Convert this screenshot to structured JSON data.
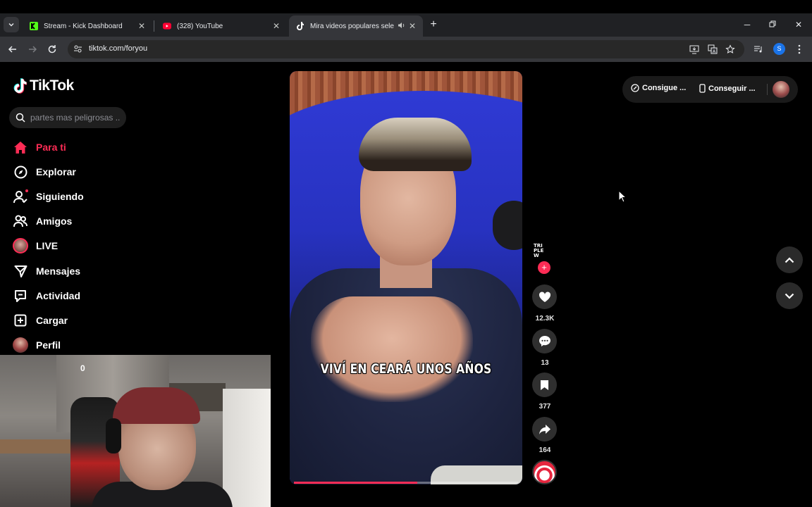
{
  "browser": {
    "tabs": [
      {
        "title": "Stream - Kick Dashboard",
        "favicon": "kick-icon"
      },
      {
        "title": "(328) YouTube",
        "favicon": "youtube-icon"
      },
      {
        "title": "Mira videos populares sele",
        "favicon": "tiktok-icon",
        "active": true
      }
    ],
    "url": "tiktok.com/foryou",
    "profile_initial": "S",
    "colors": {
      "frame": "#202124",
      "toolbar": "#35363a"
    }
  },
  "tiktok": {
    "brand": "TikTok",
    "search_placeholder": "partes mas peligrosas ...",
    "nav": [
      {
        "label": "Para ti",
        "icon": "home-icon",
        "active": true
      },
      {
        "label": "Explorar",
        "icon": "compass-icon"
      },
      {
        "label": "Siguiendo",
        "icon": "following-icon"
      },
      {
        "label": "Amigos",
        "icon": "friends-icon"
      },
      {
        "label": "LIVE",
        "icon": "live-avatar"
      },
      {
        "label": "Mensajes",
        "icon": "messages-icon"
      },
      {
        "label": "Actividad",
        "icon": "activity-icon"
      },
      {
        "label": "Cargar",
        "icon": "upload-icon"
      },
      {
        "label": "Perfil",
        "icon": "profile-avatar"
      }
    ],
    "video": {
      "caption": "VIVÍ EN CEARÁ UNOS AÑOS",
      "progress": 0.55,
      "author_badge": [
        "TRI",
        "PLE",
        "W"
      ]
    },
    "actions": {
      "likes": "12.3K",
      "comments": "13",
      "saves": "377",
      "shares": "164"
    },
    "top_right": {
      "get_coins": "Consigue ...",
      "get_app": "Conseguir ..."
    },
    "accent": "#fe2c55"
  },
  "webcam": {
    "overlay_text": "0"
  }
}
